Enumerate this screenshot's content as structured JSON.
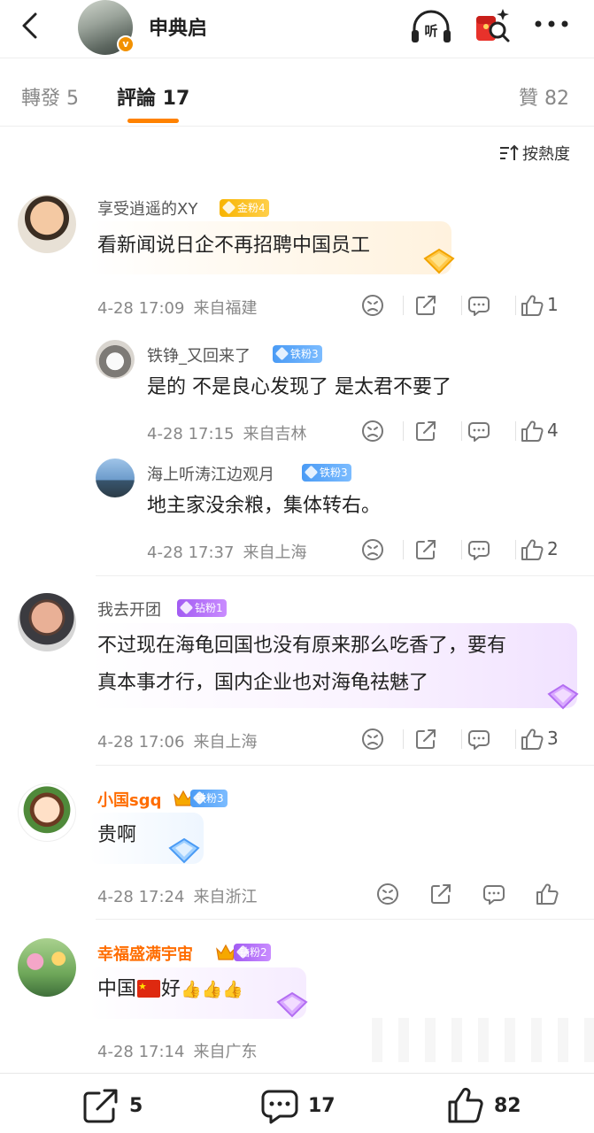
{
  "header": {
    "username": "申典启",
    "verified_badge": "v",
    "listen_label": "听",
    "icons": [
      "back-arrow-icon",
      "listen-headphones-icon",
      "red-packet-search-icon",
      "more-dots-icon"
    ]
  },
  "tabs": {
    "repost": "轉發 5",
    "comments": "評論 17",
    "likes": "贊 82"
  },
  "sort_label": "按熱度",
  "comments": [
    {
      "user": "享受逍遥的XY",
      "badge": "金粉4",
      "text": "看新闻说日企不再招聘中国员工",
      "time": "4-28 17:09",
      "location": "来自福建",
      "likes": "1"
    },
    {
      "user": "铁铮_又回来了",
      "badge": "铁粉3",
      "text": "是的 不是良心发现了 是太君不要了",
      "time": "4-28 17:15",
      "location": "来自吉林",
      "likes": "4"
    },
    {
      "user": "海上听涛江边观月",
      "badge": "铁粉3",
      "text": "地主家没余粮，集体转右。",
      "time": "4-28 17:37",
      "location": "来自上海",
      "likes": "2"
    },
    {
      "user": "我去开团",
      "badge": "钻粉1",
      "text_line1": "不过现在海龟回国也没有原来那么吃香了，要有",
      "text_line2": "真本事才行，国内企业也对海龟祛魅了",
      "time": "4-28 17:06",
      "location": "来自上海",
      "likes": "3"
    },
    {
      "user": "小国sgq",
      "badge": "铁粉3",
      "text": "贵啊",
      "time": "4-28 17:24",
      "location": "来自浙江",
      "likes": ""
    },
    {
      "user": "幸福盛满宇宙",
      "badge": "钻粉2",
      "text_part1": "中国",
      "text_part2": "好",
      "emoji": "👍👍👍",
      "time": "4-28 17:14",
      "location": "来自广东",
      "likes": ""
    }
  ],
  "bottom_bar": {
    "reposts": "5",
    "comments": "17",
    "likes": "82"
  },
  "colors": {
    "accent_orange": "#ff8200",
    "gold_badge": "#f8b400",
    "iron_badge": "#4a9bf5",
    "diamond_badge": "#a25cf2"
  }
}
